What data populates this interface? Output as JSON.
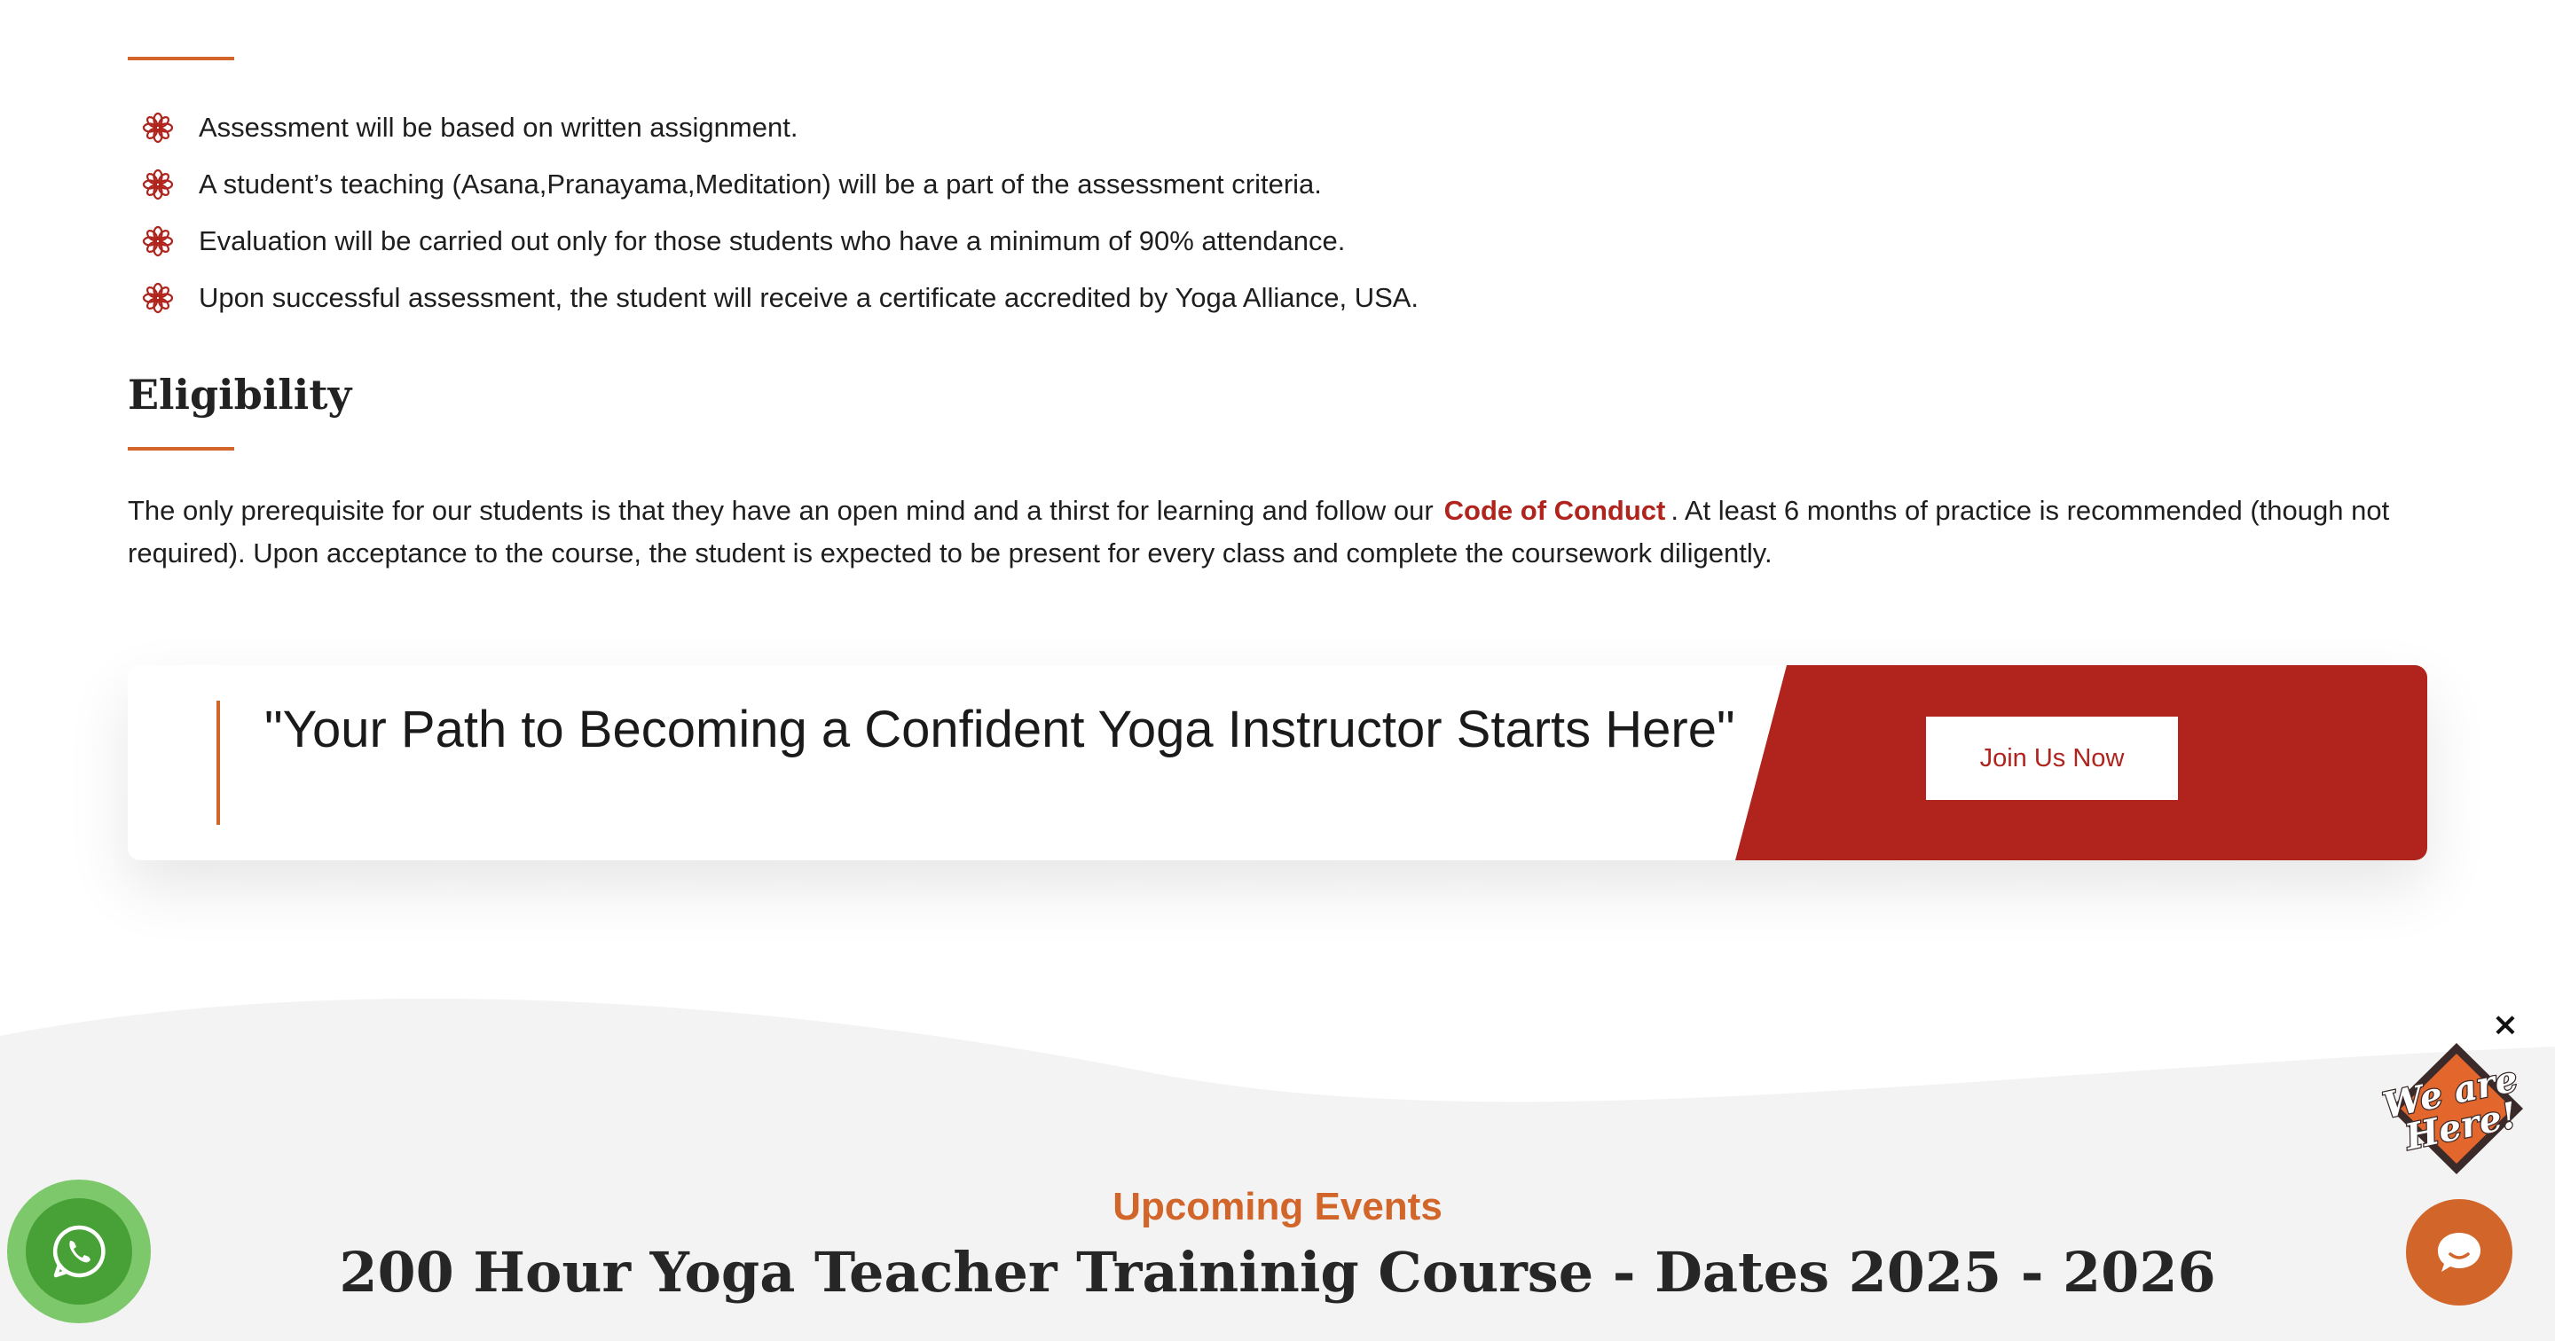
{
  "assessment": {
    "items": [
      {
        "text": "Assessment will be based on written assignment."
      },
      {
        "text": "A student’s teaching (Asana,Pranayama,Meditation) will be a part of the assessment criteria."
      },
      {
        "text": "Evaluation will be carried out only for those students who have a minimum of 90% attendance."
      },
      {
        "text": "Upon successful assessment, the student will receive a certificate accredited by Yoga Alliance, USA."
      }
    ],
    "bullet_icon": "lotus-flower-icon"
  },
  "eligibility": {
    "heading": "Eligibility",
    "text_before_link": "The only prerequisite for our students is that they have an open mind and a thirst for learning and follow our",
    "link_text": "Code of Conduct",
    "text_after_link": ". At least 6 months of practice is recommended (though not required). Upon acceptance to the course, the student is expected to be present for every class and complete the coursework diligently."
  },
  "cta": {
    "quote": "\"Your Path to Becoming a Confident Yoga Instructor Starts Here\"",
    "button_label": "Join Us Now"
  },
  "events": {
    "eyebrow": "Upcoming Events",
    "title": "200 Hour Yoga Teacher Traininig Course - Dates 2025 - 2026"
  },
  "widgets": {
    "whatsapp_icon": "whatsapp-icon",
    "badge_text_line1": "We are",
    "badge_text_line2": "Here!",
    "close_symbol": "×",
    "chat_icon": "chat-bubble-icon"
  },
  "colors": {
    "accent": "#d2662a",
    "brand_red": "#b0241d",
    "whatsapp_green": "#48a137",
    "section_bg": "#f3f3f3"
  }
}
